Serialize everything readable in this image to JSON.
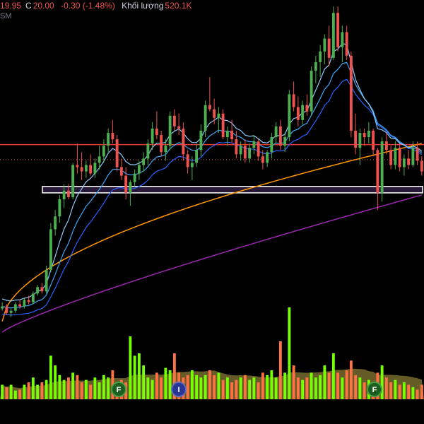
{
  "header": {
    "low_val": "19.95",
    "close_label": "C",
    "close_val": "20.00",
    "change": "-0.30 (-1.48%)",
    "volume_label": "Khối lượng",
    "volume_val": "520.1K",
    "sub_label": "SM"
  },
  "chart_data": {
    "type": "candlestick",
    "y_range": [
      12.5,
      28.0
    ],
    "candles": [
      [
        13.6,
        13.9,
        13.5,
        13.7
      ],
      [
        13.7,
        13.8,
        13.3,
        13.4
      ],
      [
        13.4,
        13.6,
        13.2,
        13.5
      ],
      [
        13.5,
        13.9,
        13.4,
        13.8
      ],
      [
        13.8,
        14.0,
        13.6,
        13.7
      ],
      [
        13.7,
        14.1,
        13.6,
        14.0
      ],
      [
        14.0,
        14.2,
        13.8,
        13.9
      ],
      [
        13.9,
        14.4,
        13.8,
        14.3
      ],
      [
        14.3,
        14.7,
        14.2,
        14.6
      ],
      [
        14.6,
        14.8,
        14.3,
        14.4
      ],
      [
        14.4,
        15.6,
        14.3,
        15.4
      ],
      [
        15.4,
        17.6,
        15.3,
        17.3
      ],
      [
        17.3,
        18.2,
        17.0,
        17.9
      ],
      [
        17.9,
        18.9,
        17.6,
        18.7
      ],
      [
        18.7,
        19.4,
        18.3,
        19.1
      ],
      [
        19.1,
        19.4,
        18.7,
        18.8
      ],
      [
        18.8,
        20.4,
        18.7,
        20.3
      ],
      [
        20.3,
        21.3,
        19.9,
        20.2
      ],
      [
        20.2,
        20.9,
        19.6,
        20.0
      ],
      [
        20.0,
        20.5,
        19.7,
        20.3
      ],
      [
        20.3,
        20.8,
        19.8,
        19.9
      ],
      [
        19.9,
        20.6,
        19.7,
        20.4
      ],
      [
        20.4,
        21.2,
        20.1,
        20.7
      ],
      [
        20.7,
        21.5,
        20.4,
        21.2
      ],
      [
        21.2,
        22.0,
        20.9,
        21.8
      ],
      [
        21.8,
        22.4,
        21.3,
        21.5
      ],
      [
        21.5,
        21.7,
        20.0,
        20.2
      ],
      [
        20.2,
        20.6,
        19.6,
        19.8
      ],
      [
        19.8,
        20.2,
        18.7,
        19.0
      ],
      [
        19.0,
        19.6,
        18.4,
        19.5
      ],
      [
        19.5,
        20.1,
        19.3,
        19.9
      ],
      [
        19.9,
        20.5,
        19.6,
        20.3
      ],
      [
        20.3,
        20.9,
        20.0,
        20.6
      ],
      [
        20.6,
        21.5,
        20.3,
        21.3
      ],
      [
        21.3,
        22.3,
        21.0,
        22.0
      ],
      [
        22.0,
        22.8,
        21.5,
        21.7
      ],
      [
        21.7,
        21.9,
        20.7,
        20.9
      ],
      [
        20.9,
        21.5,
        20.5,
        21.2
      ],
      [
        21.2,
        22.8,
        21.0,
        22.6
      ],
      [
        22.6,
        22.9,
        21.9,
        22.1
      ],
      [
        22.1,
        22.7,
        21.7,
        22.0
      ],
      [
        22.0,
        22.3,
        20.5,
        20.8
      ],
      [
        20.8,
        21.0,
        19.9,
        20.2
      ],
      [
        20.2,
        20.7,
        19.6,
        20.4
      ],
      [
        20.4,
        21.3,
        20.2,
        21.0
      ],
      [
        21.0,
        22.2,
        20.7,
        21.9
      ],
      [
        21.9,
        23.3,
        21.6,
        23.1
      ],
      [
        23.1,
        24.4,
        22.8,
        22.9
      ],
      [
        22.9,
        23.4,
        22.2,
        22.5
      ],
      [
        22.5,
        23.0,
        21.8,
        22.7
      ],
      [
        22.7,
        22.9,
        21.5,
        21.6
      ],
      [
        21.6,
        22.1,
        21.2,
        21.9
      ],
      [
        21.9,
        22.4,
        21.3,
        21.5
      ],
      [
        21.5,
        21.9,
        20.6,
        20.8
      ],
      [
        20.8,
        21.4,
        20.5,
        21.2
      ],
      [
        21.2,
        21.5,
        20.4,
        20.6
      ],
      [
        20.6,
        21.3,
        20.4,
        21.1
      ],
      [
        21.1,
        21.7,
        20.8,
        21.4
      ],
      [
        21.4,
        21.5,
        20.5,
        20.7
      ],
      [
        20.7,
        21.0,
        20.1,
        20.4
      ],
      [
        20.4,
        21.0,
        20.2,
        20.9
      ],
      [
        20.9,
        21.8,
        20.6,
        21.6
      ],
      [
        21.6,
        22.3,
        21.3,
        22.1
      ],
      [
        22.1,
        22.4,
        21.0,
        21.2
      ],
      [
        21.2,
        21.8,
        20.9,
        21.6
      ],
      [
        21.6,
        23.8,
        21.4,
        23.6
      ],
      [
        23.6,
        24.2,
        22.8,
        23.0
      ],
      [
        23.0,
        23.5,
        22.1,
        22.4
      ],
      [
        22.4,
        23.3,
        22.2,
        23.1
      ],
      [
        23.1,
        23.6,
        22.6,
        22.8
      ],
      [
        22.8,
        24.9,
        22.6,
        24.7
      ],
      [
        24.7,
        25.4,
        24.1,
        25.1
      ],
      [
        25.1,
        25.9,
        24.4,
        25.6
      ],
      [
        25.6,
        26.4,
        25.0,
        26.2
      ],
      [
        26.2,
        26.8,
        24.9,
        25.3
      ],
      [
        25.3,
        27.7,
        25.2,
        27.4
      ],
      [
        27.4,
        27.7,
        25.6,
        25.8
      ],
      [
        25.8,
        26.8,
        25.1,
        26.5
      ],
      [
        26.5,
        26.8,
        25.2,
        25.4
      ],
      [
        25.4,
        25.6,
        21.6,
        21.9
      ],
      [
        21.9,
        22.7,
        20.8,
        21.1
      ],
      [
        21.1,
        22.0,
        20.3,
        21.8
      ],
      [
        21.8,
        22.0,
        21.2,
        21.6
      ],
      [
        21.6,
        22.3,
        21.3,
        21.9
      ],
      [
        21.9,
        22.0,
        20.7,
        21.0
      ],
      [
        21.0,
        21.1,
        18.2,
        19.0
      ],
      [
        19.0,
        21.6,
        18.6,
        21.4
      ],
      [
        21.4,
        21.8,
        20.8,
        21.0
      ],
      [
        21.0,
        21.2,
        20.1,
        20.3
      ],
      [
        20.3,
        21.4,
        20.1,
        21.1
      ],
      [
        21.1,
        21.3,
        20.0,
        20.2
      ],
      [
        20.2,
        20.8,
        19.8,
        20.6
      ],
      [
        20.6,
        21.0,
        20.1,
        20.3
      ],
      [
        20.3,
        21.4,
        20.2,
        21.1
      ],
      [
        21.1,
        21.4,
        20.3,
        20.5
      ],
      [
        20.5,
        20.7,
        19.8,
        20.0
      ]
    ],
    "volume": [
      0.3,
      0.25,
      0.3,
      0.18,
      0.2,
      0.3,
      0.35,
      0.45,
      0.3,
      0.35,
      0.4,
      0.9,
      0.7,
      0.5,
      0.4,
      0.45,
      0.55,
      0.5,
      0.35,
      0.4,
      0.3,
      0.45,
      0.35,
      0.5,
      0.45,
      0.6,
      0.35,
      0.4,
      0.35,
      1.3,
      0.9,
      0.95,
      0.7,
      0.45,
      0.4,
      0.55,
      0.45,
      0.65,
      0.6,
      0.95,
      0.55,
      0.45,
      0.5,
      0.6,
      0.5,
      0.45,
      0.5,
      0.6,
      0.5,
      0.55,
      0.4,
      0.45,
      0.35,
      0.4,
      0.45,
      0.5,
      0.4,
      0.45,
      0.35,
      0.55,
      0.5,
      0.6,
      0.45,
      1.2,
      0.55,
      1.9,
      0.7,
      0.45,
      0.4,
      0.45,
      0.55,
      0.45,
      0.5,
      0.7,
      0.55,
      0.95,
      0.55,
      0.45,
      0.6,
      0.8,
      0.5,
      0.45,
      0.35,
      0.4,
      0.3,
      0.55,
      0.7,
      0.45,
      0.35,
      0.4,
      0.3,
      0.35,
      0.3,
      0.25,
      0.2,
      0.3
    ],
    "levels": {
      "red_line": 21.25,
      "dotted_line": 20.55,
      "zone": [
        19.0,
        19.3
      ]
    },
    "marker_labels": [
      "F",
      "I",
      "F"
    ],
    "colors": {
      "up": "#4caf50",
      "down": "#ef5350",
      "ma_light": "#90caf9",
      "ma_mid": "#42a5f5",
      "ma_dark": "#2962ff",
      "ma_orange": "#ff9800",
      "ma_purple": "#9c27b0",
      "vol_up": "#76ff03",
      "vol_down": "#ff7043",
      "vol_ma": "#b8a646"
    }
  }
}
